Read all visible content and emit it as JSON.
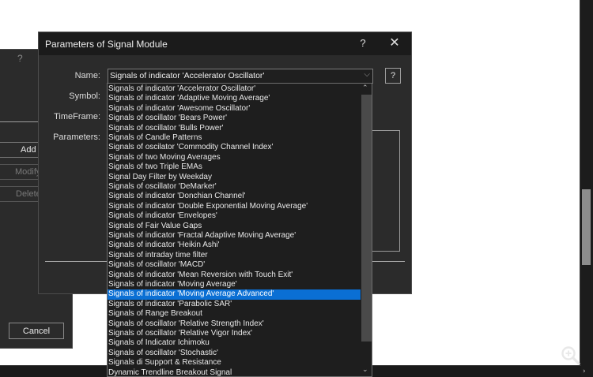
{
  "dialog": {
    "title": "Parameters of Signal Module",
    "help_glyph": "?",
    "close_glyph": "✕",
    "labels": {
      "name": "Name:",
      "symbol": "Symbol:",
      "timeframe": "TimeFrame:",
      "parameters": "Parameters:"
    },
    "name_value": "Signals of indicator 'Accelerator Oscillator'",
    "help_button": "?"
  },
  "dropdown": {
    "options": [
      "Signals of indicator 'Accelerator Oscillator'",
      "Signals of indicator 'Adaptive Moving Average'",
      "Signals of indicator 'Awesome Oscillator'",
      "Signals of oscillator 'Bears Power'",
      "Signals of oscillator 'Bulls Power'",
      "Signals of Candle Patterns",
      "Signals of oscilator 'Commodity Channel Index'",
      "Signals of two Moving Averages",
      "Signals of two Triple EMAs",
      "Signal Day Filter by Weekday",
      "Signals of oscillator 'DeMarker'",
      "Signals of indicator 'Donchian Channel'",
      "Signals of indicator 'Double Exponential Moving Average'",
      "Signals of indicator 'Envelopes'",
      "Signals of Fair Value Gaps",
      "Signals of indicator 'Fractal Adaptive Moving Average'",
      "Signals of indicator 'Heikin Ashi'",
      "Signals of intraday time filter",
      "Signals of oscillator 'MACD'",
      "Signals of indicator 'Mean Reversion with Touch Exit'",
      "Signals of indicator 'Moving Average'",
      "Signals of indicator 'Moving Average Advanced'",
      "Signals of indicator 'Parabolic SAR'",
      "Signals of Range Breakout",
      "Signals of oscillator 'Relative Strength Index'",
      "Signals of oscillator 'Relative Vigor Index'",
      "Signals of Indicator Ichimoku",
      "Signals of oscillator 'Stochastic'",
      "Signals di Support & Resistance",
      "Dynamic Trendline Breakout Signal"
    ],
    "selected_index": 21
  },
  "background_dialog": {
    "help_glyph": "?",
    "add_label": "Add",
    "modify_label": "Modify",
    "delete_label": "Delete",
    "cancel_label": "Cancel"
  },
  "colors": {
    "dialog_bg": "#2b2b2b",
    "titlebar_bg": "#1b1b1b",
    "selection": "#0a6fd4"
  },
  "icons": {
    "zoom": "magnifier-plus-icon",
    "close": "close-icon",
    "dropdown_caret": "chevron-down-icon"
  }
}
